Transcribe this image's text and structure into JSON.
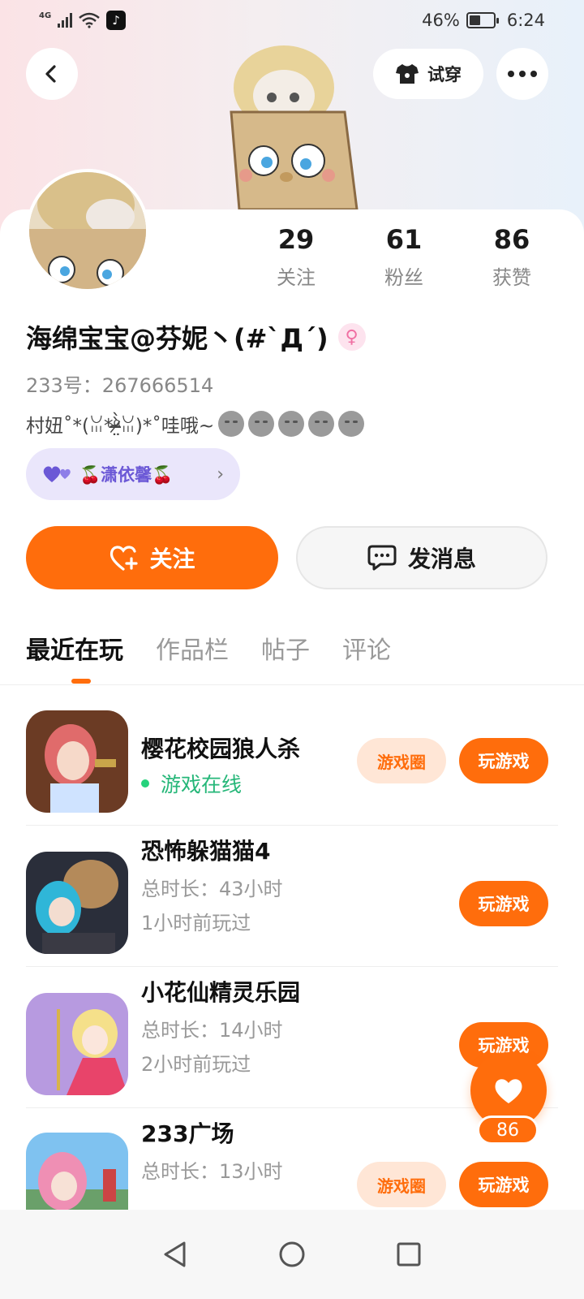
{
  "status_bar": {
    "network": "4G",
    "battery_percent": "46%",
    "time": "6:24",
    "battery_level": 0.46
  },
  "header": {
    "back_icon": "chevron-left-icon",
    "tryon_label": "试穿",
    "more_icon": "more-horizontal-icon"
  },
  "profile": {
    "stats": [
      {
        "value": "29",
        "label": "关注"
      },
      {
        "value": "61",
        "label": "粉丝"
      },
      {
        "value": "86",
        "label": "获赞"
      }
    ],
    "name": "海绵宝宝@芬妮丶(#`Д´)",
    "gender_symbol": "♀",
    "uid": "233号：267666514",
    "bio": "村妞˚*(ꈍ*ᵒ̴̶̷̤̀̀ꈍ)*˚哇哦~",
    "cp_name": "🍒潇依馨🍒",
    "cp_chevron": "›"
  },
  "actions": {
    "follow_label": "关注",
    "message_label": "发消息"
  },
  "tabs": [
    "最近在玩",
    "作品栏",
    "帖子",
    "评论"
  ],
  "games": [
    {
      "title": "樱花校园狼人杀",
      "status": "游戏在线",
      "circle_label": "游戏圈",
      "play_label": "玩游戏"
    },
    {
      "title": "恐怖躲猫猫4",
      "duration": "总时长：43小时",
      "last_played": "1小时前玩过",
      "play_label": "玩游戏"
    },
    {
      "title": "小花仙精灵乐园",
      "duration": "总时长：14小时",
      "last_played": "2小时前玩过",
      "play_label": "玩游戏"
    },
    {
      "title": "233广场",
      "duration": "总时长：13小时",
      "circle_label": "游戏圈",
      "play_label": "玩游戏"
    }
  ],
  "like_fab": {
    "count": "86"
  },
  "colors": {
    "accent": "#ff6d0c",
    "online": "#26b779",
    "cp": "#6b58d6"
  }
}
